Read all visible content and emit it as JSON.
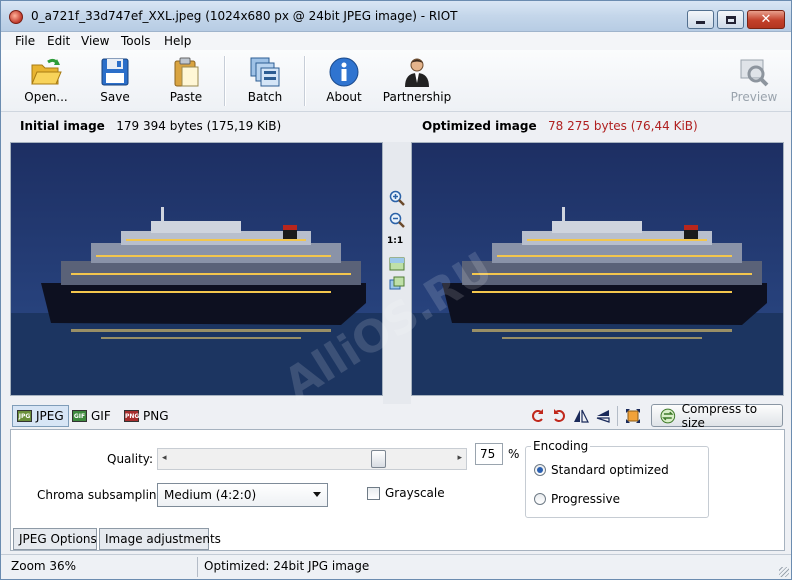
{
  "window": {
    "title": "0_a721f_33d747ef_XXL.jpeg (1024x680 px @ 24bit JPEG image) - RIOT"
  },
  "menu": [
    "File",
    "Edit",
    "View",
    "Tools",
    "Help"
  ],
  "toolbar": {
    "open": "Open...",
    "save": "Save",
    "paste": "Paste",
    "batch": "Batch",
    "about": "About",
    "partnership": "Partnership",
    "preview": "Preview"
  },
  "initial": {
    "label": "Initial image",
    "size": "179 394 bytes (175,19 KiB)"
  },
  "optimized": {
    "label": "Optimized image",
    "size": "78 275 bytes (76,44 KiB)"
  },
  "zoom_panel": {
    "one_to_one": "1:1"
  },
  "formats": {
    "jpeg": "JPEG",
    "gif": "GIF",
    "png": "PNG",
    "jpeg_icon": "JPG",
    "gif_icon": "GIF",
    "png_icon": "PNG"
  },
  "compress_button": "Compress to size",
  "options": {
    "quality_label": "Quality:",
    "quality_value": "75",
    "quality_fraction": 0.75,
    "percent": "%",
    "chroma_label": "Chroma subsampling:",
    "chroma_value": "Medium (4:2:0)",
    "grayscale": "Grayscale",
    "encoding_title": "Encoding",
    "standard": "Standard optimized",
    "progressive": "Progressive"
  },
  "bottom_tabs": {
    "jpeg_options": "JPEG Options",
    "image_adjustments": "Image adjustments"
  },
  "status": {
    "zoom": "Zoom 36%",
    "info": "Optimized: 24bit JPG image"
  },
  "watermark": "AlliOS.RU",
  "colors": {
    "accent": "#2a5fb0",
    "optimized_size": "#b02020",
    "night_sky": "#1d2f63",
    "sea": "#1c3561"
  }
}
